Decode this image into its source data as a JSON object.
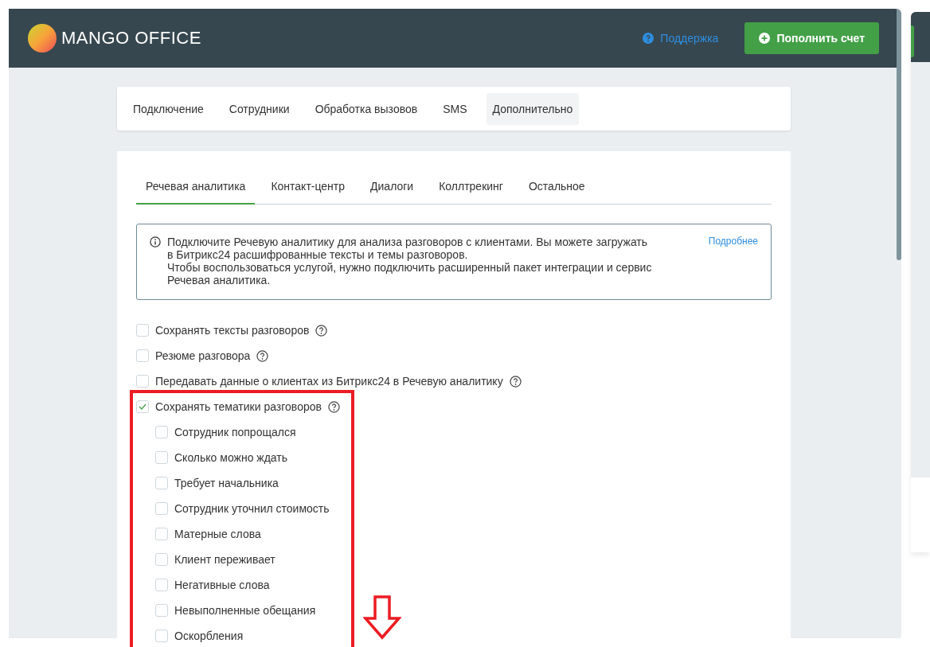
{
  "header": {
    "logo": "**MANGO** OFFICE",
    "support_link": "Поддержка",
    "topup_button": "Пополнить счет"
  },
  "nav_tabs": [
    {
      "label": "Подключение",
      "selected": false
    },
    {
      "label": "Сотрудники",
      "selected": false
    },
    {
      "label": "Обработка вызовов",
      "selected": false
    },
    {
      "label": "SMS",
      "selected": false
    },
    {
      "label": "Дополнительно",
      "selected": true
    }
  ],
  "section_tabs": [
    {
      "label": "Речевая аналитика",
      "selected": true
    },
    {
      "label": "Контакт-центр",
      "selected": false
    },
    {
      "label": "Диалоги",
      "selected": false
    },
    {
      "label": "Коллтрекинг",
      "selected": false
    },
    {
      "label": "Остальное",
      "selected": false
    }
  ],
  "info": {
    "text": "Подключите Речевую аналитику для анализа разговоров с клиентами. Вы можете загружать\nв Битрикс24 расшифрованные тексты и темы разговоров.\nЧтобы воспользоваться услугой, нужно подключить расширенный пакет интеграции и сервис\nРечевая аналитика.",
    "link": "Подробнее"
  },
  "options": [
    {
      "label": "Сохранять тексты разговоров",
      "checked": false,
      "help": true
    },
    {
      "label": "Резюме разговора",
      "checked": false,
      "help": true
    },
    {
      "label": "Передавать данные о клиентах из Битрикс24 в Речевую аналитику",
      "checked": false,
      "help": true
    },
    {
      "label": "Сохранять тематики разговоров",
      "checked": true,
      "help": true,
      "children": [
        {
          "label": "Сотрудник попрощался",
          "checked": false,
          "help": false
        },
        {
          "label": "Сколько можно ждать",
          "checked": false,
          "help": false
        },
        {
          "label": "Требует начальника",
          "checked": false,
          "help": false
        },
        {
          "label": "Сотрудник уточнил стоимость",
          "checked": false,
          "help": false
        },
        {
          "label": "Матерные слова",
          "checked": false,
          "help": false
        },
        {
          "label": "Клиент переживает",
          "checked": false,
          "help": false
        },
        {
          "label": "Негативные слова",
          "checked": false,
          "help": false
        },
        {
          "label": "Невыполненные обещания",
          "checked": false,
          "help": false
        },
        {
          "label": "Оскорбления",
          "checked": false,
          "help": false
        }
      ]
    }
  ]
}
